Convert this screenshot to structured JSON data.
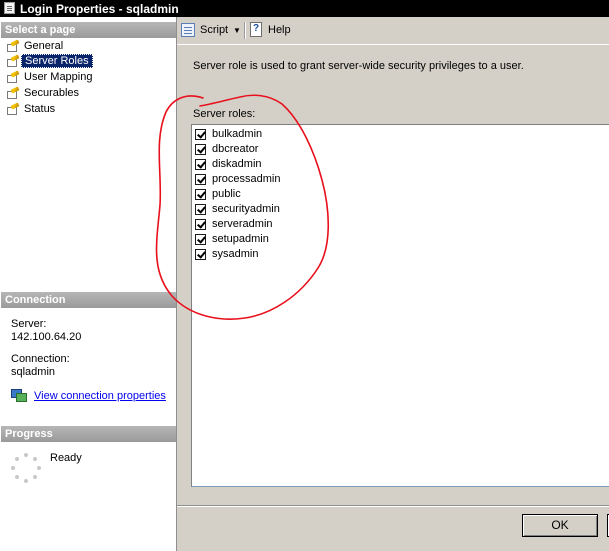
{
  "window": {
    "title": "Login Properties - sqladmin"
  },
  "left_pane": {
    "select_page_header": "Select a page",
    "pages": [
      {
        "label": "General",
        "selected": false
      },
      {
        "label": "Server Roles",
        "selected": true
      },
      {
        "label": "User Mapping",
        "selected": false
      },
      {
        "label": "Securables",
        "selected": false
      },
      {
        "label": "Status",
        "selected": false
      }
    ],
    "connection_header": "Connection",
    "server_label": "Server:",
    "server_value": "142.100.64.20",
    "connection_label": "Connection:",
    "connection_value": "sqladmin",
    "view_connection_link": "View connection properties",
    "progress_header": "Progress",
    "progress_status": "Ready"
  },
  "toolbar": {
    "script_label": "Script",
    "script_caret": "▼",
    "help_label": "Help"
  },
  "main": {
    "description": "Server role is used to grant server-wide security privileges to a user.",
    "roles_label": "Server roles:",
    "roles": [
      {
        "name": "bulkadmin",
        "checked": true
      },
      {
        "name": "dbcreator",
        "checked": true
      },
      {
        "name": "diskadmin",
        "checked": true
      },
      {
        "name": "processadmin",
        "checked": true
      },
      {
        "name": "public",
        "checked": true
      },
      {
        "name": "securityadmin",
        "checked": true
      },
      {
        "name": "serveradmin",
        "checked": true
      },
      {
        "name": "setupadmin",
        "checked": true
      },
      {
        "name": "sysadmin",
        "checked": true
      }
    ]
  },
  "footer": {
    "ok_label": "OK"
  },
  "annotation": {
    "color": "#e8101c",
    "shape": "hand-drawn loop around server roles"
  }
}
